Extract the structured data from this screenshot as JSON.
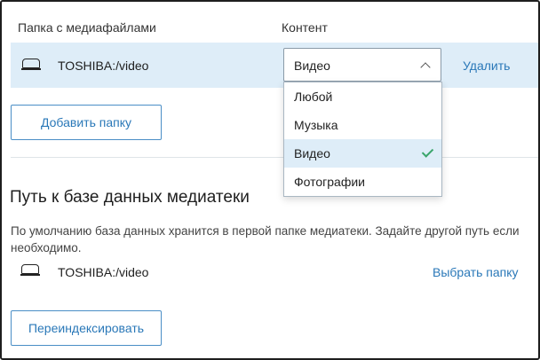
{
  "table": {
    "col_folder": "Папка с медиафайлами",
    "col_content": "Контент",
    "row": {
      "path": "TOSHIBA:/video",
      "content": "Видео",
      "remove_label": "Удалить"
    }
  },
  "dropdown": {
    "options": [
      "Любой",
      "Музыка",
      "Видео",
      "Фотографии"
    ],
    "selected": "Видео"
  },
  "add_folder_label": "Добавить папку",
  "db_section": {
    "title": "Путь к базе данных медиатеки",
    "description": "По умолчанию база данных хранится в первой папке медиатеки. Задайте другой путь если необходимо.",
    "path": "TOSHIBA:/video",
    "choose_label": "Выбрать папку"
  },
  "reindex_label": "Переиндексировать",
  "colors": {
    "accent": "#2a78b8",
    "row_highlight": "#deedf8",
    "check": "#3aa56b"
  },
  "icons": [
    "drive-icon",
    "chevron-up-icon",
    "checkmark-icon"
  ]
}
